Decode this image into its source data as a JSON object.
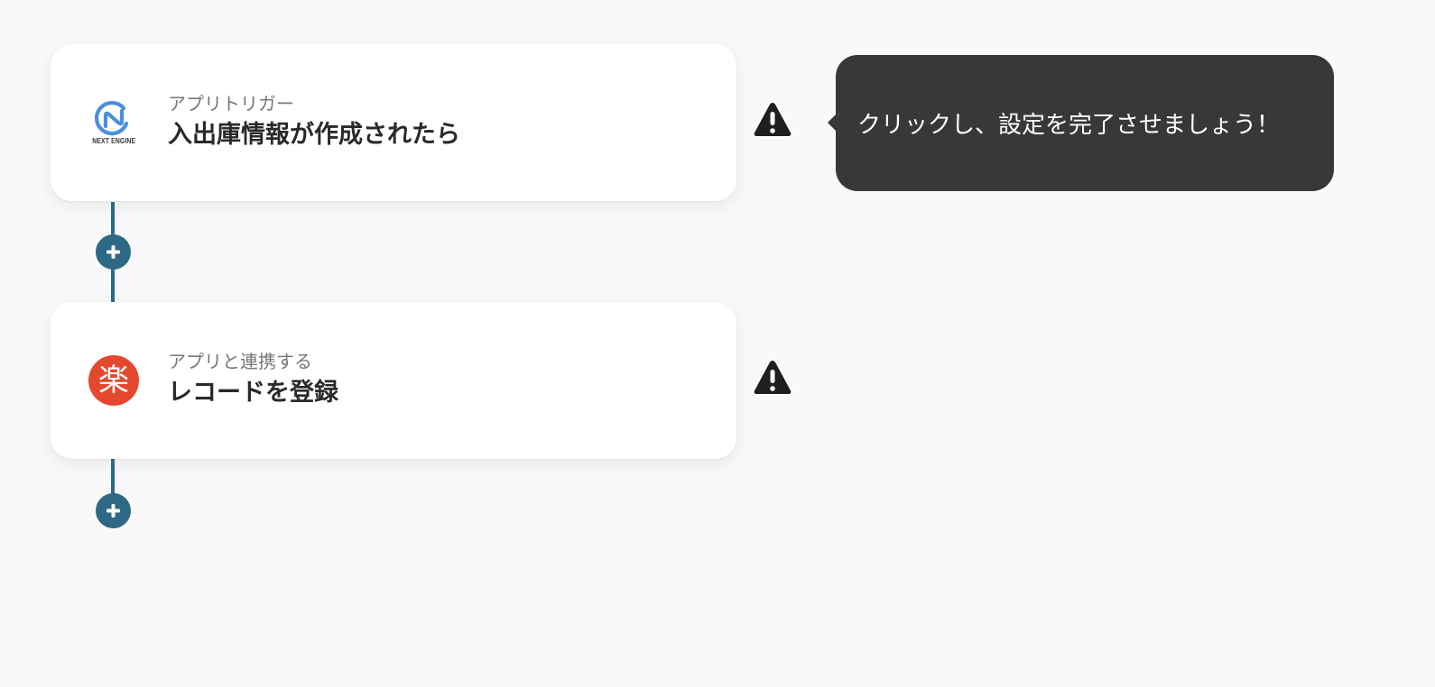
{
  "steps": [
    {
      "kind": "アプリトリガー",
      "title": "入出庫情報が作成されたら",
      "app_logo_text": "NEXT ENGINE",
      "app_icon": "next-engine-logo"
    },
    {
      "kind": "アプリと連携する",
      "title": "レコードを登録",
      "app_logo_text": "楽",
      "app_icon": "raku-logo"
    }
  ],
  "tooltip": {
    "text": "クリックし、設定を完了させましょう！"
  },
  "icons": {
    "add": "plus-icon",
    "warning": "warning-icon"
  },
  "colors": {
    "connector": "#2d6985",
    "warning": "#1f1f1f",
    "tooltip_bg": "#383838",
    "raku_red": "#e4492f",
    "next_engine_blue": "#4a8fe0"
  }
}
